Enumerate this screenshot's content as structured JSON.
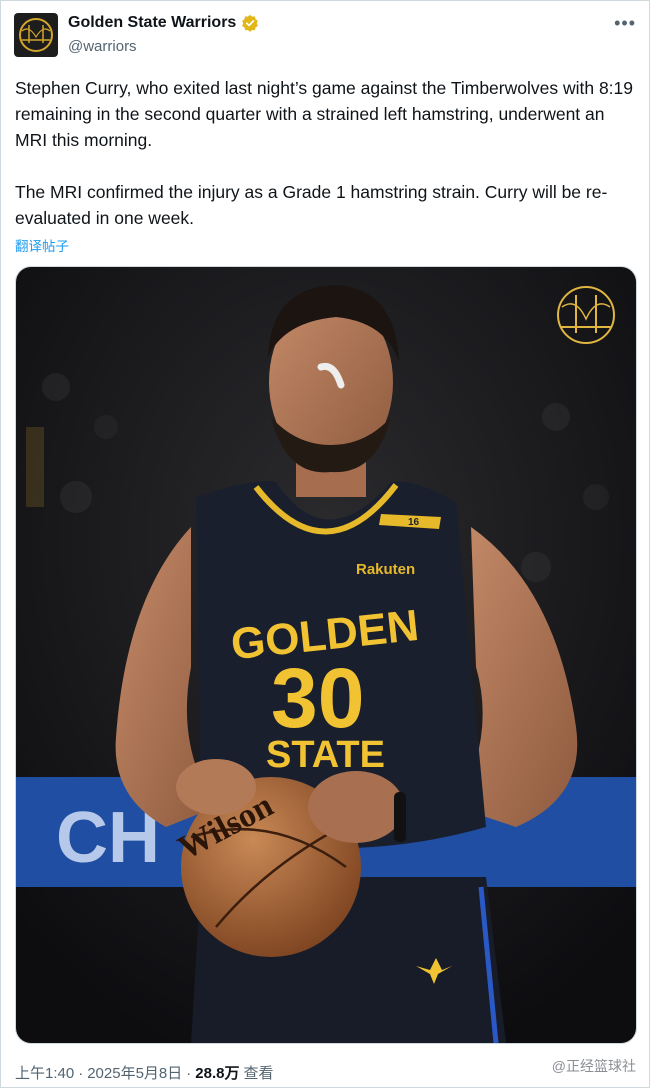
{
  "account": {
    "display_name": "Golden State Warriors",
    "handle": "@warriors",
    "verified_icon": "gold-verified-badge",
    "more_icon": "more-options-icon"
  },
  "tweet": {
    "paragraphs": [
      "Stephen Curry, who exited last night’s game against the Timberwolves with 8:19 remaining in the second quarter with a strained left hamstring, underwent an MRI this morning.",
      "The MRI confirmed the injury as a Grade 1 hamstring strain. Curry will be re-evaluated in one week."
    ],
    "translate_label": "翻译帖子"
  },
  "media": {
    "jersey_text": "GOLDEN",
    "jersey_text_2": "STATE",
    "jersey_number": "30",
    "sponsor": "Rakuten",
    "strap_number": "16",
    "ball_brand": "Wilson",
    "banner_text": "CH"
  },
  "footer": {
    "time": "上午1:40",
    "sep1": "·",
    "date": "2025年5月8日",
    "sep2": "·",
    "views_count": "28.8万",
    "views_label": "查看"
  },
  "watermark": "@正经篮球社",
  "colors": {
    "gold": "#f1c232",
    "jersey": "#1a1f2e",
    "link": "#1d9bf0",
    "muted": "#536471"
  }
}
